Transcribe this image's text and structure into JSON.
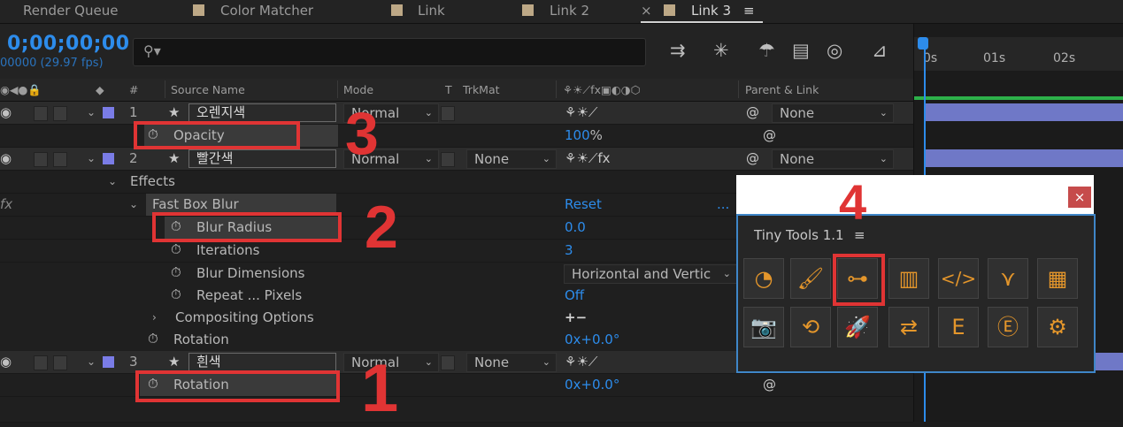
{
  "tabs": [
    {
      "label": "Render Queue"
    },
    {
      "label": "Color Matcher"
    },
    {
      "label": "Link"
    },
    {
      "label": "Link 2"
    },
    {
      "label": "Link 3",
      "close": "×",
      "menu": "≡"
    }
  ],
  "timecode": "0;00;00;00",
  "fps_label": "00000 (29.97 fps)",
  "search": {
    "icon": "search-icon",
    "glyph": "⚲▾"
  },
  "columns": {
    "source_name": "Source Name",
    "mode": "Mode",
    "t": "T",
    "trkmat": "TrkMat",
    "parent_link": "Parent & Link",
    "hash": "#"
  },
  "ruler": {
    "t0": "0s",
    "t1": "01s",
    "t2": "02s"
  },
  "layers": [
    {
      "number": "1",
      "name": "오렌지색",
      "mode": "Normal",
      "trkmat": "",
      "parent": "None"
    },
    {
      "number": "2",
      "name": "빨간색",
      "mode": "Normal",
      "trkmat": "None",
      "parent": "None"
    },
    {
      "number": "3",
      "name": "흰색",
      "mode": "Normal",
      "trkmat": "None",
      "parent": ""
    }
  ],
  "props": {
    "opacity": {
      "name": "Opacity",
      "value": "100",
      "unit": "%"
    },
    "effects": "Effects",
    "fast_box_blur": "Fast Box Blur",
    "reset": "Reset",
    "blur_radius": {
      "name": "Blur Radius",
      "value": "0.0"
    },
    "iterations": {
      "name": "Iterations",
      "value": "3"
    },
    "blur_dimensions": {
      "name": "Blur Dimensions",
      "value": "Horizontal and Vertic"
    },
    "repeat_pixels": {
      "name": "Repeat ... Pixels",
      "value": "Off"
    },
    "compositing": "Compositing Options",
    "comp_value": "+−",
    "rotation2": {
      "name": "Rotation",
      "value": "0x+0.0°"
    },
    "rotation3": {
      "name": "Rotation",
      "value": "0x+0.0°"
    },
    "dots": "..."
  },
  "annotations": {
    "n1": "1",
    "n2": "2",
    "n3": "3",
    "n4": "4"
  },
  "tiny_tools": {
    "title": "Tiny Tools 1.1",
    "menu": "≡",
    "close": "×",
    "icons": [
      "eyedropper-icon",
      "broom-icon",
      "link-nodes-icon",
      "film-strip-icon",
      "code-icon",
      "merge-arrow-icon",
      "calculator-icon",
      "camera-icon",
      "history-icon",
      "rocket-icon",
      "swap-n-icon",
      "expression-e-icon",
      "search-e-icon",
      "gear-icon"
    ],
    "glyphs": [
      "◔",
      "🖌",
      "⊶",
      "▥",
      "</>",
      "⋎",
      "▦",
      "📷",
      "⟲",
      "🚀",
      "⇄",
      "E",
      "Ⓔ",
      "⚙"
    ]
  },
  "colors": {
    "accent": "#2d8ceb",
    "annotation": "#e03434",
    "label": "#7a7ce6",
    "panel_border": "#3f86c8"
  }
}
